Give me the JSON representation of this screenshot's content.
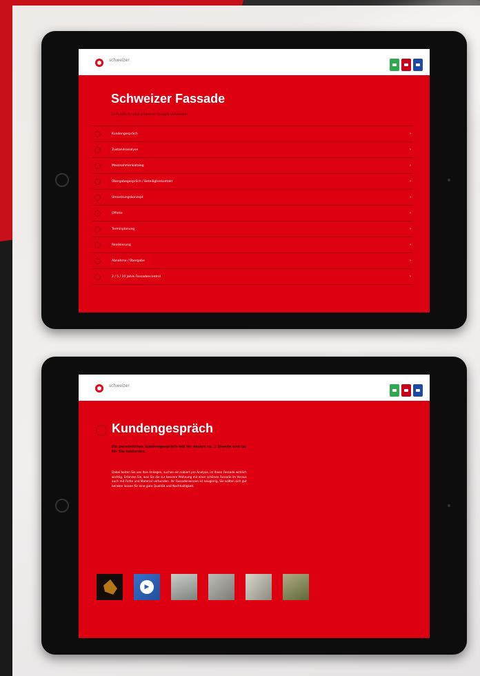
{
  "brand": "schweizer",
  "colors": {
    "accent": "#dd0011",
    "brand": "#e30613",
    "icon_green": "#2fa84f",
    "icon_red": "#c4001a",
    "icon_blue": "#1d49a8"
  },
  "app_icons": [
    "green-app-icon",
    "red-app-icon",
    "blue-app-icon"
  ],
  "screen1": {
    "title": "Schweizer Fassade",
    "subtitle": "10 Punkte für eine schweizer Fassade verwenden",
    "menu": [
      "Kundengespräch",
      "Zustandsanalyse",
      "Massnahmenkatalog",
      "Übergabegespräch / Beteiligtenkontakt",
      "Umsetzungskonzept",
      "Offerte",
      "Terminplanung",
      "Realisierung",
      "Abnahme / Übergabe",
      "2 / 5 / 10 Jahre Fassadencontrol"
    ]
  },
  "screen2": {
    "title": "Kundengespräch",
    "lead": "Ein persönliches Kundengespräch mit Ihr dauert ca. 1 Stunde und ist für Sie kostenlos.",
    "body": "Dabei beiten Sie uns Ihre Anliegen, suchen ein sobiert pro Analyse, ist Ihnen Fassade wirklich wichtig. Erfahren Sie, was Sie die zur bessere Wohnung mit einer schönen Fassade im Voraus auch mit Farbe und Material verbunden. Ihr Fassadenwissen ist neugierig, Sie sollten sich gut beraten lassen für eine gute Qualität und Nachhaltigkeit.",
    "gallery": [
      "gold-object-photo",
      "video-thumbnail",
      "worker-photo",
      "rough-surface-photo",
      "plaster-work-photo",
      "craftsman-photo"
    ]
  }
}
